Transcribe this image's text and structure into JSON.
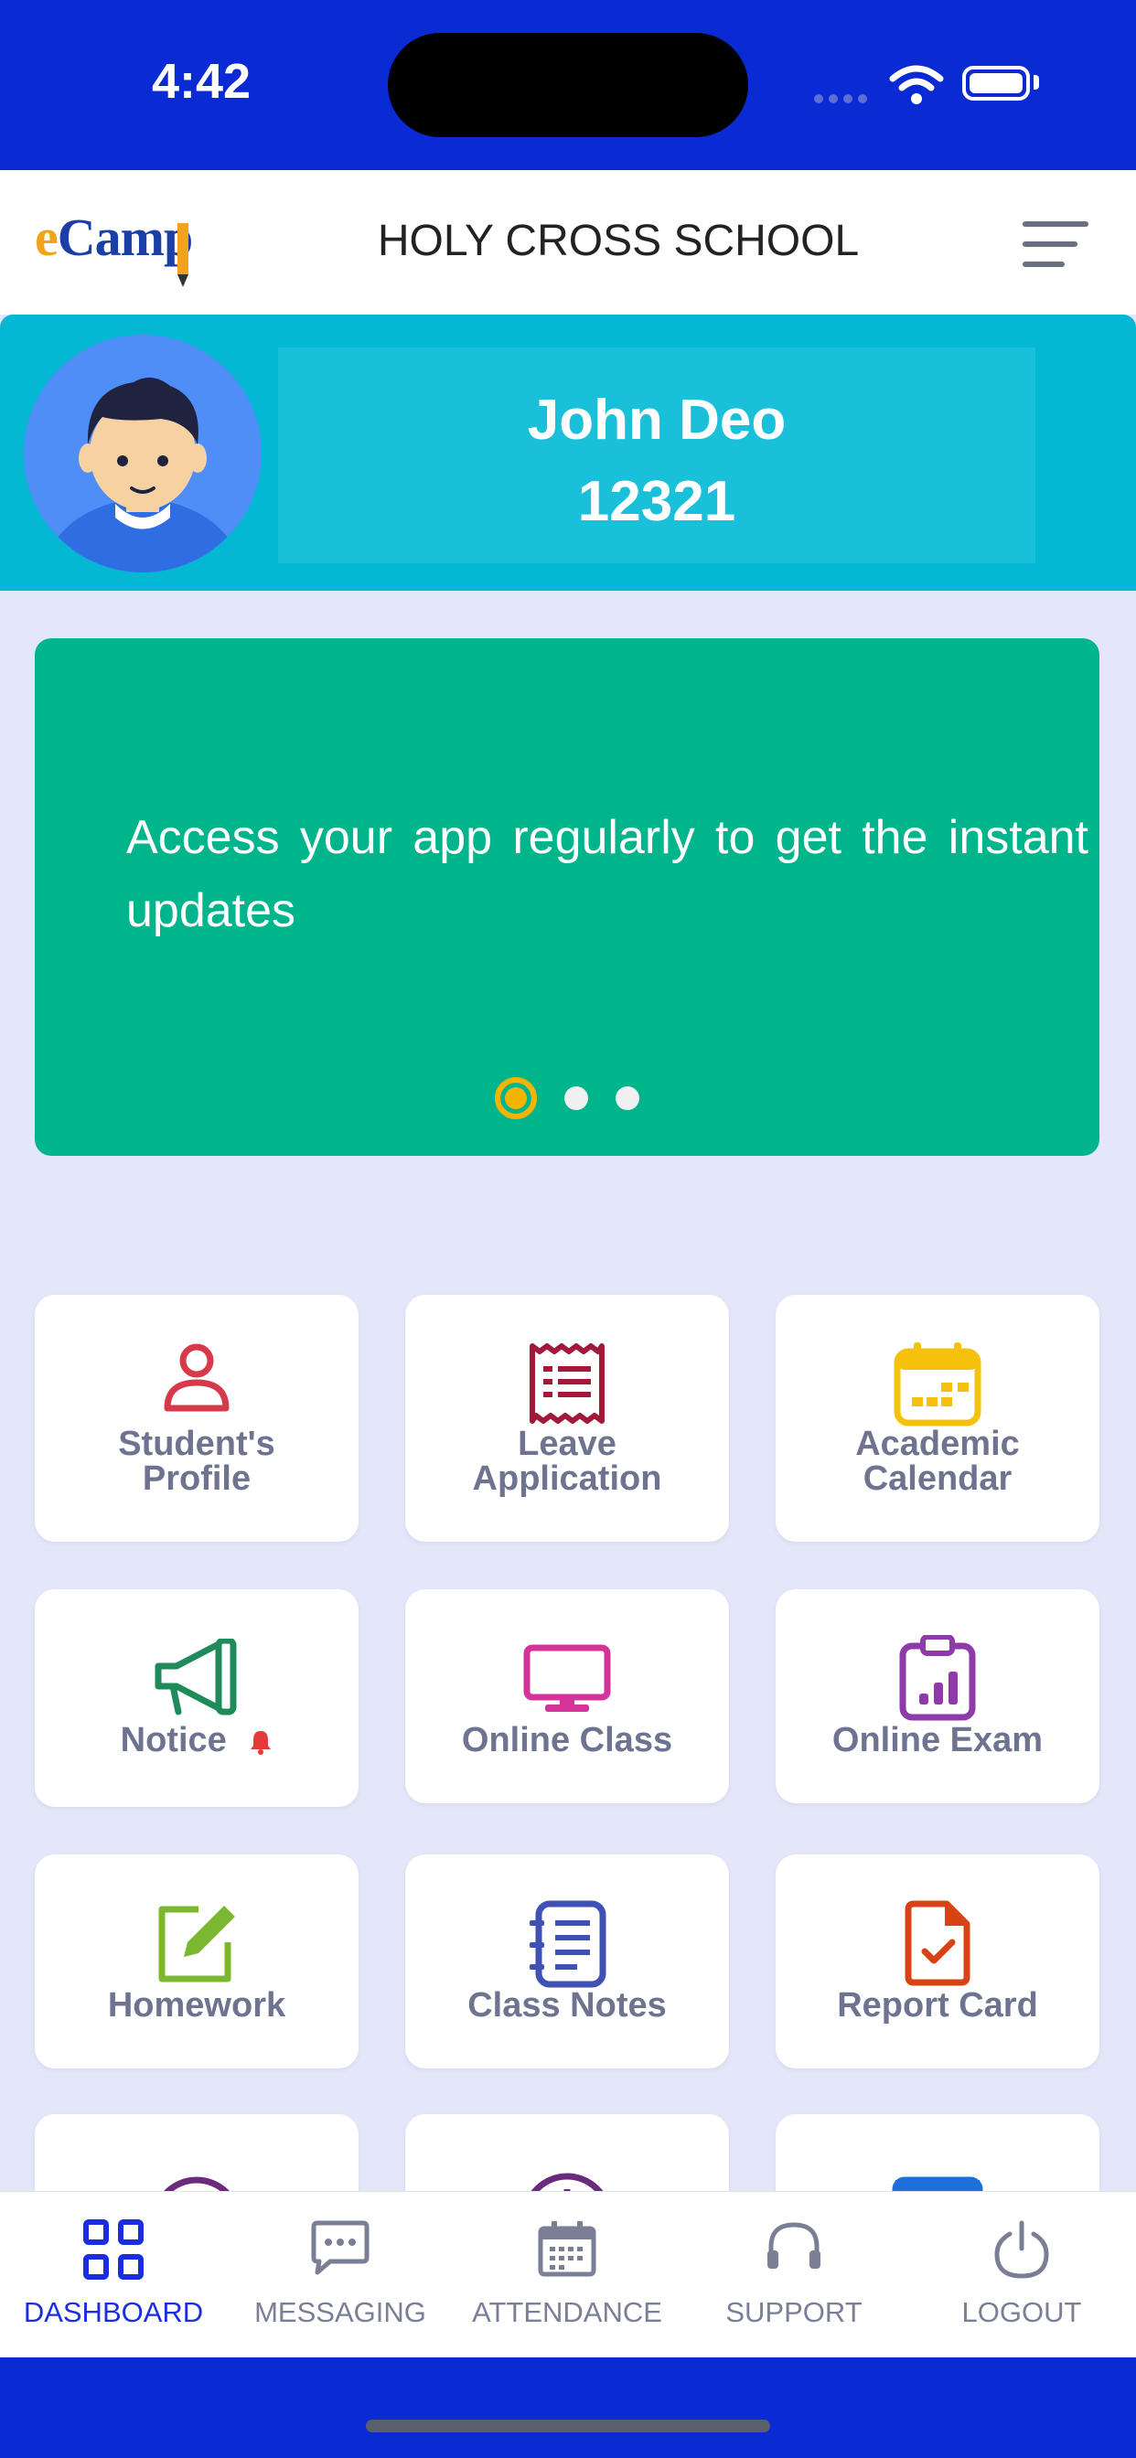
{
  "status_bar": {
    "time": "4:42"
  },
  "header": {
    "logo": "eCamp",
    "logo_e": "e",
    "logo_rest": "Camp",
    "school_name": "HOLY CROSS SCHOOL"
  },
  "profile": {
    "name": "John Deo",
    "id": "12321"
  },
  "banner": {
    "text": "Access your app regularly to get the instant updates",
    "active_slide": 1,
    "slide_count": 3
  },
  "tiles": [
    {
      "label": "Student's Profile",
      "line1": "Student's",
      "line2": "Profile",
      "icon": "user-icon",
      "color": "#d63a4a"
    },
    {
      "label": "Leave Application",
      "line1": "Leave",
      "line2": "Application",
      "icon": "receipt-icon",
      "color": "#a3193a"
    },
    {
      "label": "Academic Calendar",
      "line1": "Academic",
      "line2": "Calendar",
      "icon": "calendar-icon",
      "color": "#f4c20d"
    },
    {
      "label": "Notice",
      "icon": "megaphone-icon",
      "color": "#1f8a5a",
      "badge_color": "#e53935"
    },
    {
      "label": "Online Class",
      "icon": "monitor-icon",
      "color": "#d6339a"
    },
    {
      "label": "Online Exam",
      "icon": "clipboard-chart-icon",
      "color": "#8e3aa8"
    },
    {
      "label": "Homework",
      "icon": "edit-icon",
      "color": "#7cb82f"
    },
    {
      "label": "Class Notes",
      "icon": "notes-list-icon",
      "color": "#3f51b5"
    },
    {
      "label": "Report Card",
      "icon": "document-check-icon",
      "color": "#d84315"
    }
  ],
  "nav": [
    {
      "label": "DASHBOARD",
      "icon": "grid-icon",
      "active": true
    },
    {
      "label": "MESSAGING",
      "icon": "chat-icon",
      "active": false
    },
    {
      "label": "ATTENDANCE",
      "icon": "calendar-icon",
      "active": false
    },
    {
      "label": "SUPPORT",
      "icon": "headset-icon",
      "active": false
    },
    {
      "label": "LOGOUT",
      "icon": "power-icon",
      "active": false
    }
  ],
  "colors": {
    "status_bar": "#0a2bd3",
    "profile_bg": "#04b8d4",
    "banner_bg": "#00b48c",
    "nav_active": "#1a2ee0",
    "page_bg": "#e4e6fa"
  }
}
